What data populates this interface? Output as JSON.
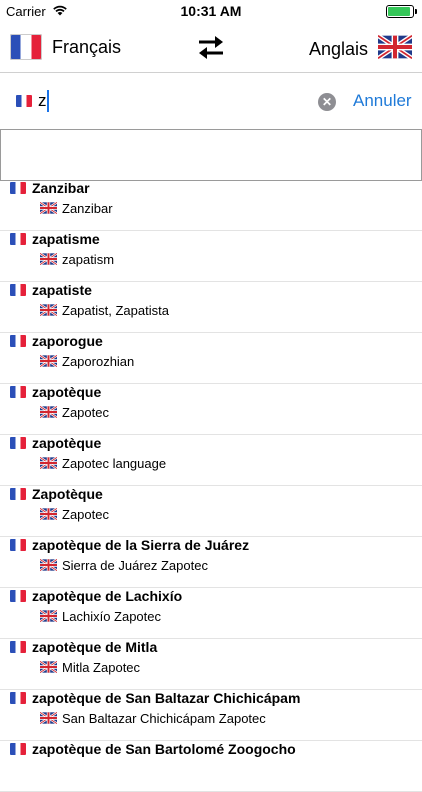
{
  "status_bar": {
    "carrier": "Carrier",
    "time": "10:31 AM",
    "battery_level": 0.85
  },
  "header": {
    "source_language": "Français",
    "target_language": "Anglais",
    "swap_icon": "swap-arrows-icon"
  },
  "search": {
    "value": "z",
    "placeholder": "",
    "cancel_label": "Annuler"
  },
  "results": [
    {
      "term": "Zanzibar",
      "translation": "Zanzibar"
    },
    {
      "term": "zapatisme",
      "translation": "zapatism"
    },
    {
      "term": "zapatiste",
      "translation": "Zapatist, Zapatista"
    },
    {
      "term": "zaporogue",
      "translation": "Zaporozhian"
    },
    {
      "term": "zapotèque",
      "translation": "Zapotec"
    },
    {
      "term": "zapotèque",
      "translation": "Zapotec language"
    },
    {
      "term": "Zapotèque",
      "translation": "Zapotec"
    },
    {
      "term": "zapotèque de la Sierra de Juárez",
      "translation": "Sierra de Juárez Zapotec"
    },
    {
      "term": "zapotèque de Lachixío",
      "translation": "Lachixío Zapotec"
    },
    {
      "term": "zapotèque de Mitla",
      "translation": "Mitla Zapotec"
    },
    {
      "term": "zapotèque de San Baltazar Chichicápam",
      "translation": "San Baltazar Chichicápam Zapotec"
    },
    {
      "term": "zapotèque de San Bartolomé Zoogocho",
      "translation": ""
    }
  ],
  "colors": {
    "accent": "#1f7ad8",
    "fr_blue": "#2b4fb8",
    "fr_red": "#e5213a",
    "uk_blue": "#1f3a8a",
    "uk_red": "#d22630"
  }
}
